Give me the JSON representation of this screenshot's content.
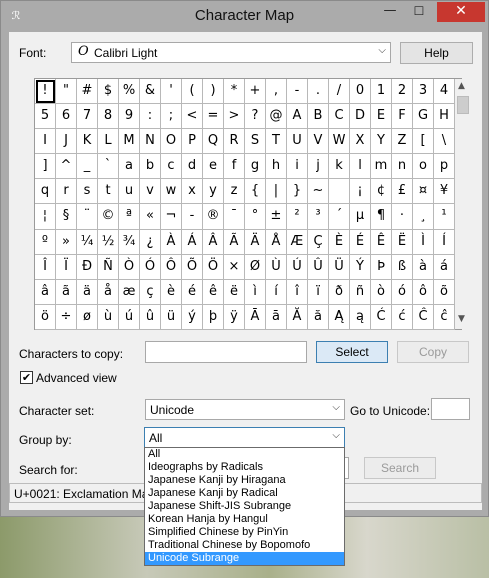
{
  "window": {
    "title": "Character Map",
    "controls": {
      "minimize": "—",
      "maximize": "☐",
      "close": "✕"
    },
    "app_icon": "character-map-icon"
  },
  "font": {
    "label": "Font:",
    "selected": "Calibri Light",
    "font_icon": "O",
    "help": "Help"
  },
  "char_grid": {
    "rows": [
      [
        "!",
        "\"",
        "#",
        "$",
        "%",
        "&",
        "'",
        "(",
        ")",
        "*",
        "+",
        ",",
        "-",
        ".",
        "/",
        "0",
        "1",
        "2",
        "3",
        "4"
      ],
      [
        "5",
        "6",
        "7",
        "8",
        "9",
        ":",
        ";",
        "<",
        "=",
        ">",
        "?",
        "@",
        "A",
        "B",
        "C",
        "D",
        "E",
        "F",
        "G",
        "H"
      ],
      [
        "I",
        "J",
        "K",
        "L",
        "M",
        "N",
        "O",
        "P",
        "Q",
        "R",
        "S",
        "T",
        "U",
        "V",
        "W",
        "X",
        "Y",
        "Z",
        "[",
        "\\"
      ],
      [
        "]",
        "^",
        "_",
        "`",
        "a",
        "b",
        "c",
        "d",
        "e",
        "f",
        "g",
        "h",
        "i",
        "j",
        "k",
        "l",
        "m",
        "n",
        "o",
        "p"
      ],
      [
        "q",
        "r",
        "s",
        "t",
        "u",
        "v",
        "w",
        "x",
        "y",
        "z",
        "{",
        "|",
        "}",
        "~",
        " ",
        "¡",
        "¢",
        "£",
        "¤",
        "¥"
      ],
      [
        "¦",
        "§",
        "¨",
        "©",
        "ª",
        "«",
        "¬",
        "-",
        "®",
        "¯",
        "°",
        "±",
        "²",
        "³",
        "´",
        "µ",
        "¶",
        "·",
        "¸",
        "¹"
      ],
      [
        "º",
        "»",
        "¼",
        "½",
        "¾",
        "¿",
        "À",
        "Á",
        "Â",
        "Ã",
        "Ä",
        "Å",
        "Æ",
        "Ç",
        "È",
        "É",
        "Ê",
        "Ë",
        "Ì",
        "Í"
      ],
      [
        "Î",
        "Ï",
        "Ð",
        "Ñ",
        "Ò",
        "Ó",
        "Ô",
        "Õ",
        "Ö",
        "×",
        "Ø",
        "Ù",
        "Ú",
        "Û",
        "Ü",
        "Ý",
        "Þ",
        "ß",
        "à",
        "á"
      ],
      [
        "â",
        "ã",
        "ä",
        "å",
        "æ",
        "ç",
        "è",
        "é",
        "ê",
        "ë",
        "ì",
        "í",
        "î",
        "ï",
        "ð",
        "ñ",
        "ò",
        "ó",
        "ô",
        "õ"
      ],
      [
        "ö",
        "÷",
        "ø",
        "ù",
        "ú",
        "û",
        "ü",
        "ý",
        "þ",
        "ÿ",
        "Ā",
        "ā",
        "Ă",
        "ă",
        "Ą",
        "ą",
        "Ć",
        "ć",
        "Ĉ",
        "ĉ"
      ]
    ],
    "selected_char": "!"
  },
  "copy": {
    "label": "Characters to copy:",
    "value": "",
    "select_button": "Select",
    "copy_button": "Copy"
  },
  "advanced_view": {
    "label": "Advanced view",
    "checked": true,
    "check_glyph": "✔"
  },
  "character_set": {
    "label": "Character set:",
    "selected": "Unicode"
  },
  "go_to_unicode": {
    "label": "Go to Unicode:",
    "value": ""
  },
  "group_by": {
    "label": "Group by:",
    "selected": "All",
    "open": true,
    "options": [
      "All",
      "Ideographs by Radicals",
      "Japanese Kanji by Hiragana",
      "Japanese Kanji by Radical",
      "Japanese Shift-JIS Subrange",
      "Korean Hanja by Hangul",
      "Simplified Chinese by PinYin",
      "Traditional Chinese by Bopomofo",
      "Unicode Subrange"
    ],
    "highlighted": "Unicode Subrange"
  },
  "search": {
    "label": "Search for:",
    "button": "Search"
  },
  "status_bar": {
    "text": "U+0021: Exclamation Mark"
  }
}
